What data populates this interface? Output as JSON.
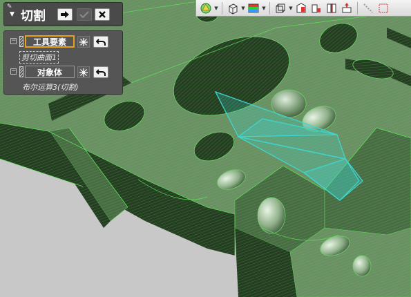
{
  "command": {
    "title": "切割",
    "ok_icon": "arrow-right-icon",
    "apply_icon": "checkmark-icon",
    "cancel_icon": "close-icon"
  },
  "elements": {
    "tool": {
      "label": "工具要素",
      "selected_item": "剪切曲面1"
    },
    "object": {
      "label": "对象体",
      "selected_item": "布尔运算3(切割)"
    }
  },
  "toolbar": {
    "icons": [
      "display-style-icon",
      "view-orientation-icon",
      "render-color-icon",
      "wireframe-box-icon",
      "section-icon",
      "section-plane-icon",
      "split-view-icon",
      "explode-icon",
      "measure-icon",
      "select-filter-icon"
    ]
  },
  "colors": {
    "model_fill": "#2f5a2c",
    "model_edge": "#4fc24a",
    "tool_surface": "#3ed6d0",
    "highlight": "#e8a21a",
    "panel_bg": "#555555"
  }
}
